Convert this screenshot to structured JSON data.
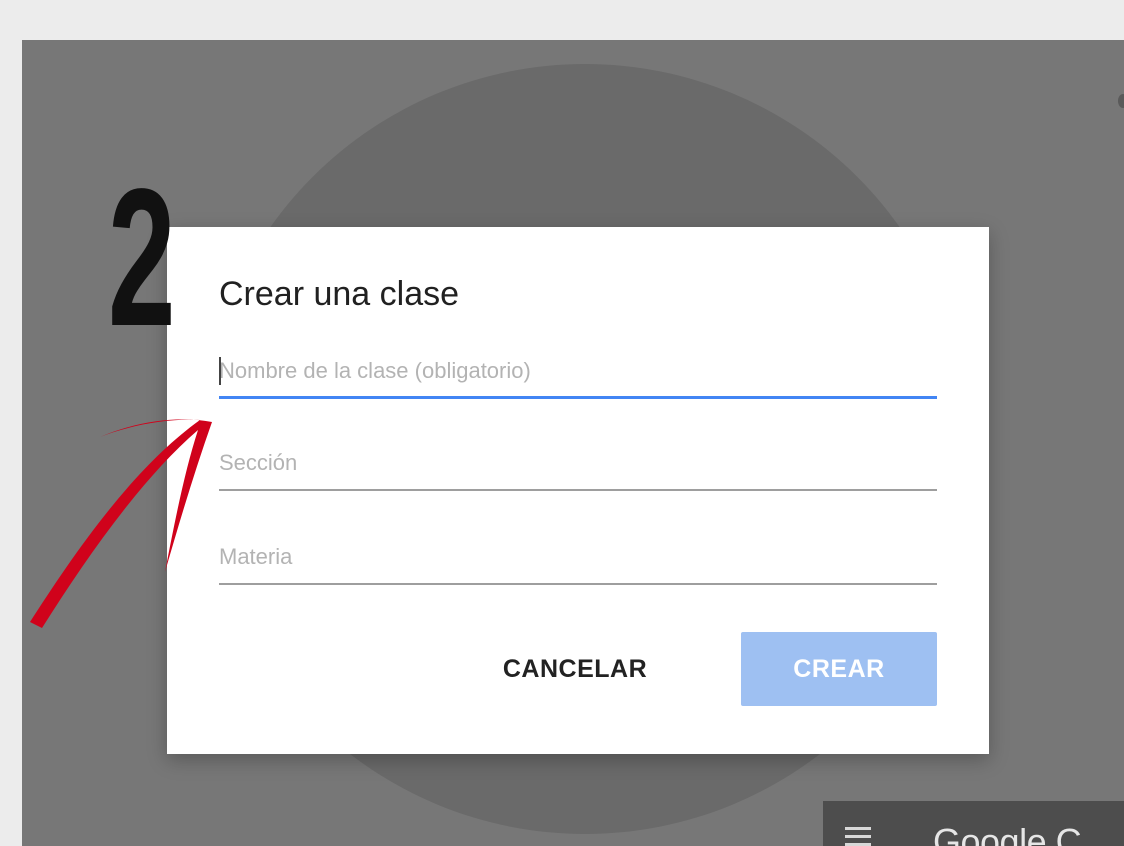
{
  "dialog": {
    "title": "Crear una clase",
    "fields": {
      "name_placeholder": "Nombre de la clase (obligatorio)",
      "name_value": "",
      "section_placeholder": "Sección",
      "section_value": "",
      "subject_placeholder": "Materia",
      "subject_value": ""
    },
    "cancel_label": "CANCELAR",
    "create_label": "CREAR"
  },
  "annotation": {
    "step_number": "2",
    "arrow_color": "#d0021b"
  },
  "background": {
    "brand_text": "Google C"
  },
  "colors": {
    "accent": "#4285f4",
    "create_button_disabled": "#9ec0f2",
    "overlay": "#777777"
  },
  "icons": {
    "menu": "hamburger-menu-icon"
  }
}
